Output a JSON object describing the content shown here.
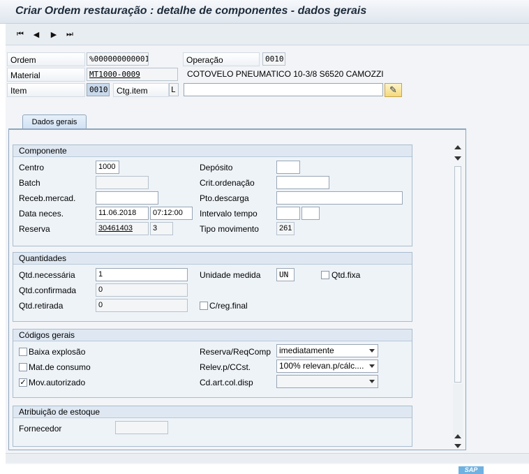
{
  "window": {
    "title": "Criar Ordem restauração : detalhe de componentes - dados gerais"
  },
  "toolbar": {
    "first_icon": "⏮",
    "prev_icon": "◀",
    "next_icon": "▶",
    "last_icon": "⏭"
  },
  "header": {
    "ordem_label": "Ordem",
    "ordem_value": "%000000000001",
    "operacao_label": "Operação",
    "operacao_value": "0010",
    "material_label": "Material",
    "material_value": "MT1000-0009",
    "material_desc": "COTOVELO PNEUMATICO 10-3/8 S6520 CAMOZZI",
    "item_label": "Item",
    "item_value": "0010",
    "ctg_item_label": "Ctg.item",
    "ctg_item_value": "L",
    "long_text_value": "",
    "edit_icon": "✎"
  },
  "tabs": [
    {
      "label": "Dados gerais"
    }
  ],
  "componente": {
    "title": "Componente",
    "centro_label": "Centro",
    "centro_value": "1000",
    "batch_label": "Batch",
    "batch_value": "",
    "receb_label": "Receb.mercad.",
    "receb_value": "",
    "data_label": "Data neces.",
    "data_value": "11.06.2018",
    "hora_value": "07:12:00",
    "reserva_label": "Reserva",
    "reserva_value": "30461403",
    "reserva_item_value": "3",
    "deposito_label": "Depósito",
    "deposito_value": "",
    "crit_label": "Crit.ordenação",
    "crit_value": "",
    "pto_label": "Pto.descarga",
    "pto_value": "",
    "intervalo_label": "Intervalo tempo",
    "intervalo_value1": "",
    "intervalo_value2": "",
    "tipo_mov_label": "Tipo movimento",
    "tipo_mov_value": "261"
  },
  "quantidades": {
    "title": "Quantidades",
    "necessaria_label": "Qtd.necessária",
    "necessaria_value": "1",
    "confirmada_label": "Qtd.confirmada",
    "confirmada_value": "0",
    "retirada_label": "Qtd.retirada",
    "retirada_value": "0",
    "unidade_label": "Unidade medida",
    "unidade_value": "UN",
    "qtd_fixa_label": "Qtd.fixa",
    "qtd_fixa_checked": false,
    "creg_label": "C/reg.final",
    "creg_checked": false
  },
  "codigos": {
    "title": "Códigos gerais",
    "baixa_label": "Baixa explosão",
    "baixa_checked": false,
    "mat_consumo_label": "Mat.de consumo",
    "mat_consumo_checked": false,
    "mov_aut_label": "Mov.autorizado",
    "mov_aut_checked": true,
    "reserva_req_label": "Reserva/ReqComp",
    "reserva_req_value": "imediatamente",
    "relev_label": "Relev.p/CCst.",
    "relev_value": "100% relevan.p/cálc....",
    "cdart_label": "Cd.art.col.disp",
    "cdart_value": ""
  },
  "atribuicao": {
    "title": "Atribuição de estoque",
    "fornecedor_label": "Fornecedor",
    "fornecedor_value": ""
  },
  "footer": {
    "logo_text": "SAP"
  }
}
